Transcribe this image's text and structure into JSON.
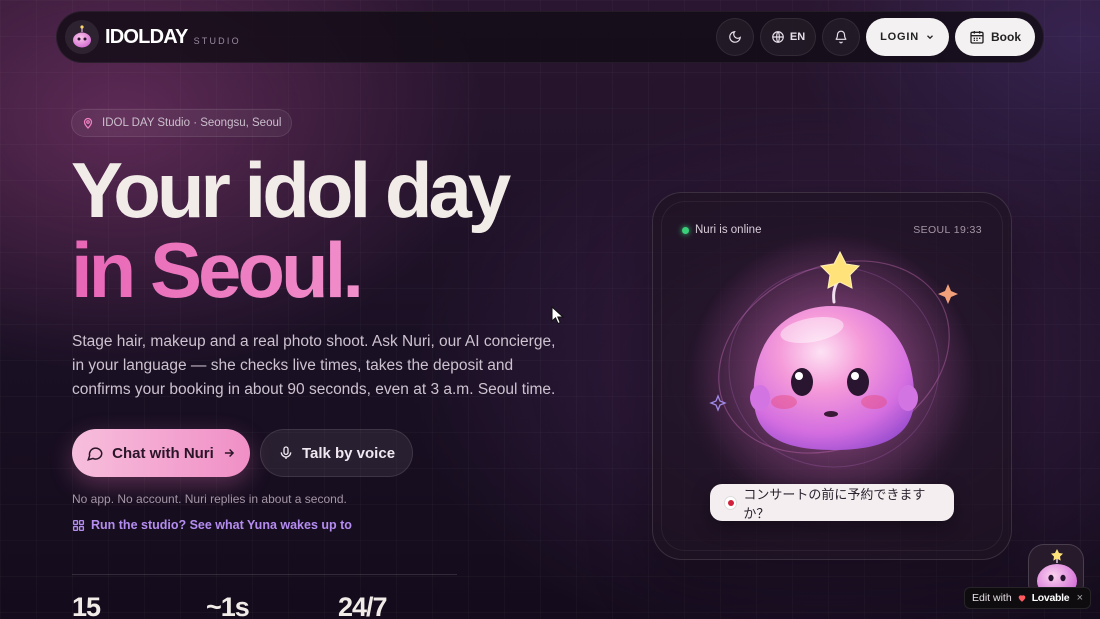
{
  "nav": {
    "brand": "IDOLDAY",
    "brand_sub": "STUDIO",
    "lang": "EN",
    "login_label": "LOGIN",
    "book_label": "Book"
  },
  "hero": {
    "location": "IDOL DAY Studio · Seongsu, Seoul",
    "title_line1": "Your idol day",
    "title_line2": "in Seoul.",
    "lede": "Stage hair, makeup and a real photo shoot. Ask Nuri, our AI concierge, in your language — she checks live times, takes the deposit and confirms your booking in about 90 seconds, even at 3 a.m. Seoul time.",
    "primary_cta": "Chat with Nuri",
    "secondary_cta": "Talk by voice",
    "note": "No app. No account. Nuri replies in about a second.",
    "studio_link": "Run the studio? See what Yuna wakes up to"
  },
  "stats": [
    "15",
    "~1s",
    "24/7"
  ],
  "card": {
    "status": "Nuri is online",
    "time": "SEOUL 19:33",
    "bubble": "コンサートの前に予約できますか？"
  },
  "badge": {
    "edit_with": "Edit with",
    "lovable": "Lovable",
    "close": "×"
  },
  "colors": {
    "accent_pink": "#f08fc6",
    "accent_purple": "#b58cf0",
    "online_green": "#3ad07a"
  }
}
